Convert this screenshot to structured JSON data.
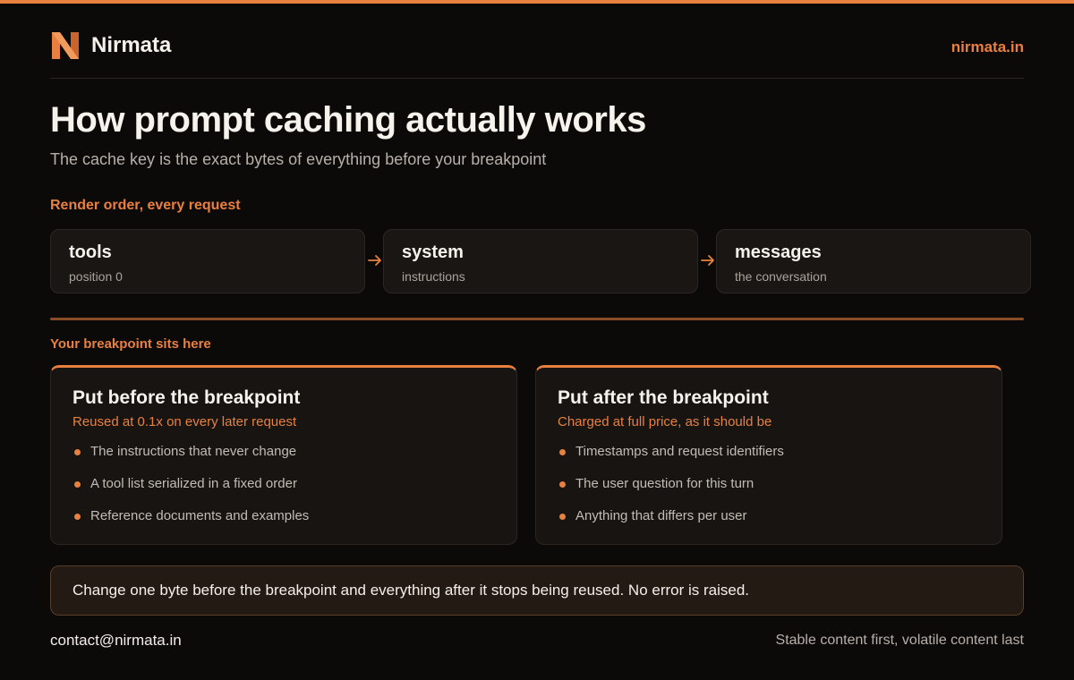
{
  "header": {
    "brand": "Nirmata",
    "site": "nirmata.in",
    "logo_icon": "nirmata-n-logo"
  },
  "title": "How prompt caching actually works",
  "subtitle": "The cache key is the exact bytes of everything before your breakpoint",
  "render_order": {
    "label": "Render order, every request",
    "items": [
      {
        "name": "tools",
        "desc": "position 0"
      },
      {
        "name": "system",
        "desc": "instructions"
      },
      {
        "name": "messages",
        "desc": "the conversation"
      }
    ],
    "arrow_icon": "arrow-right-icon"
  },
  "breakpoint_label": "Your breakpoint sits here",
  "panels": [
    {
      "title": "Put before the breakpoint",
      "subtitle": "Reused at 0.1x on every later request",
      "items": [
        "The instructions that never change",
        "A tool list serialized in a fixed order",
        "Reference documents and examples"
      ]
    },
    {
      "title": "Put after the breakpoint",
      "subtitle": "Charged at full price, as it should be",
      "items": [
        "Timestamps and request identifiers",
        "The user question for this turn",
        "Anything that differs per user"
      ]
    }
  ],
  "callout": "Change one byte before the breakpoint and everything after it stops being reused. No error is raised.",
  "footer": {
    "contact": "contact@nirmata.in",
    "tagline": "Stable content first, volatile content last"
  },
  "colors": {
    "accent": "#e8803f",
    "background": "#0c0a09",
    "card": "#1a1614"
  }
}
